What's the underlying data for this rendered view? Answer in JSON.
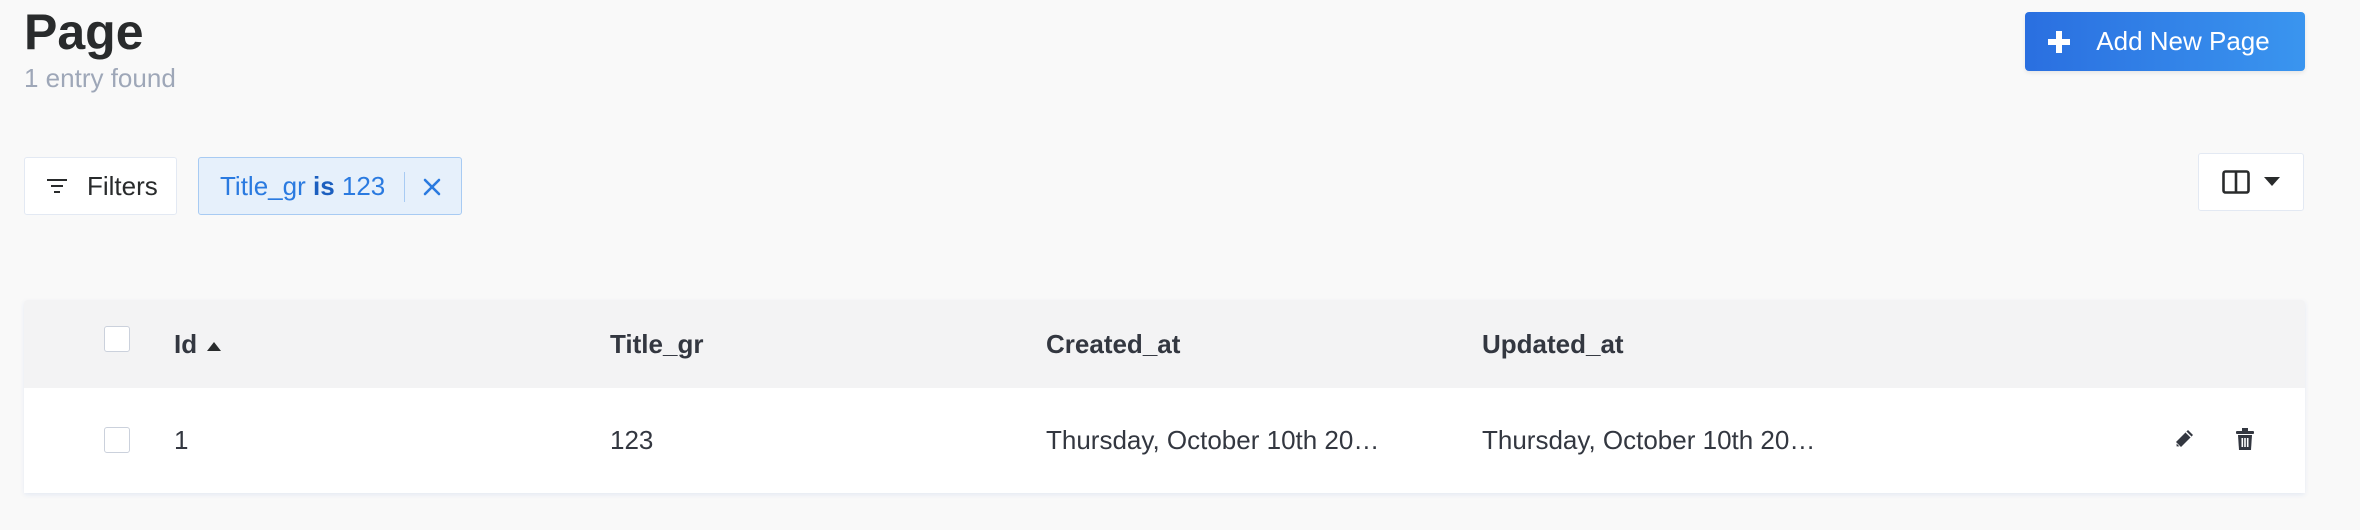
{
  "header": {
    "title": "Page",
    "entry_count": "1 entry found",
    "add_button_label": "Add New Page"
  },
  "toolbar": {
    "filters_label": "Filters",
    "active_filter": {
      "field": "Title_gr",
      "operator": "is",
      "value": "123"
    }
  },
  "table": {
    "columns": [
      "Id",
      "Title_gr",
      "Created_at",
      "Updated_at"
    ],
    "sorted_column": "Id",
    "sort_direction": "ascending",
    "rows": [
      {
        "id": "1",
        "title_gr": "123",
        "created_at": "Thursday, October 10th 20…",
        "updated_at": "Thursday, October 10th 20…"
      }
    ]
  },
  "colors": {
    "accent": "#2a6fe0",
    "chip_text": "#2a7ae0",
    "chip_bg": "#e6f0fb"
  },
  "icons": {
    "add": "plus-icon",
    "filters": "filter-icon",
    "chip_close": "close-icon",
    "columns": "layout-columns-icon",
    "columns_dropdown": "caret-down-icon",
    "sort": "sort-asc-icon",
    "edit": "pencil-icon",
    "delete": "trash-icon"
  }
}
